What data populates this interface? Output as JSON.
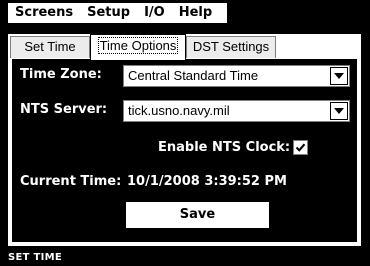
{
  "menubar": {
    "items": [
      "Screens",
      "Setup",
      "I/O",
      "Help"
    ]
  },
  "tabs": [
    {
      "label": "Set Time",
      "active": false
    },
    {
      "label": "Time Options",
      "active": true
    },
    {
      "label": "DST Settings",
      "active": false
    }
  ],
  "time_options": {
    "time_zone_label": "Time Zone:",
    "time_zone_value": "Central Standard Time",
    "nts_server_label": "NTS Server:",
    "nts_server_value": "tick.usno.navy.mil",
    "enable_nts_label": "Enable NTS Clock:",
    "enable_nts_checked": true,
    "current_time_label": "Current Time:",
    "current_time_value": "10/1/2008 3:39:52 PM",
    "save_label": "Save"
  },
  "status": {
    "text": "SET TIME"
  },
  "icons": {
    "dropdown": "chevron-down-icon",
    "check": "checkmark-icon"
  }
}
